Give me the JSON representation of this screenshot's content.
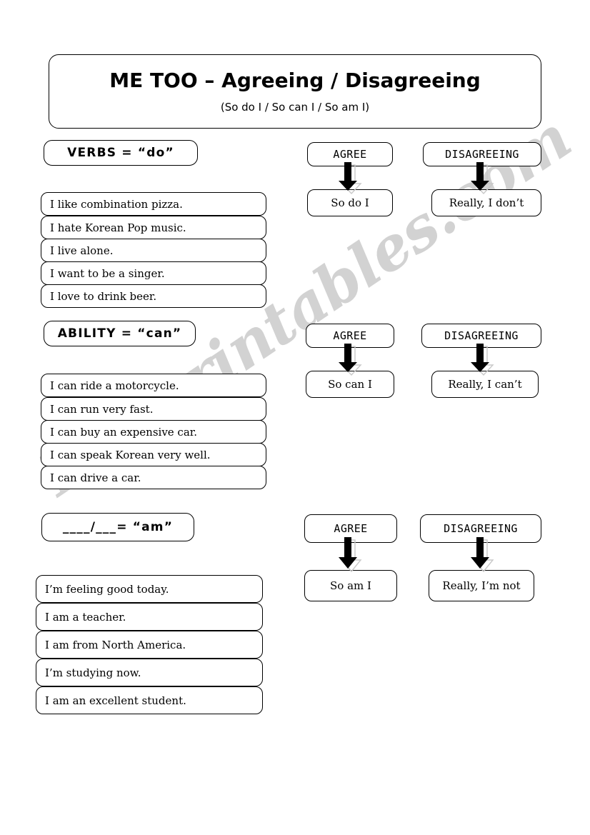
{
  "header": {
    "title": "ME TOO – Agreeing / Disagreeing",
    "subtitle": "(So do I / So can I / So am I)"
  },
  "watermark": {
    "text": "ESLprintables.com",
    "color": "#d2d2d2"
  },
  "colors": {
    "ink": "#000000",
    "page": "#ffffff",
    "arrow": "#000000",
    "arrow_shadow": "#c8c8c8"
  },
  "sections": [
    {
      "label": "VERBS = “do”",
      "statements": [
        "I like combination pizza.",
        "I hate Korean Pop music.",
        "I live alone.",
        "I want to be a singer.",
        "I love to drink beer."
      ],
      "agree": {
        "header": "AGREE",
        "answer": "So do I"
      },
      "disagree": {
        "header": "DISAGREEING",
        "answer": "Really, I don’t"
      }
    },
    {
      "label": "ABILITY = “can”",
      "statements": [
        "I can ride a motorcycle.",
        "I can run very fast.",
        "I can buy an expensive car.",
        "I can speak Korean very well.",
        "I can drive a car."
      ],
      "agree": {
        "header": "AGREE",
        "answer": "So can I"
      },
      "disagree": {
        "header": "DISAGREEING",
        "answer": "Really, I can’t"
      }
    },
    {
      "label": "____/___= “am”",
      "statements": [
        "I’m feeling good today.",
        "I am a teacher.",
        "I am from North America.",
        "I’m studying now.",
        "I am an excellent student."
      ],
      "agree": {
        "header": "AGREE",
        "answer": "So am I"
      },
      "disagree": {
        "header": "DISAGREEING",
        "answer": "Really, I’m not"
      }
    }
  ]
}
